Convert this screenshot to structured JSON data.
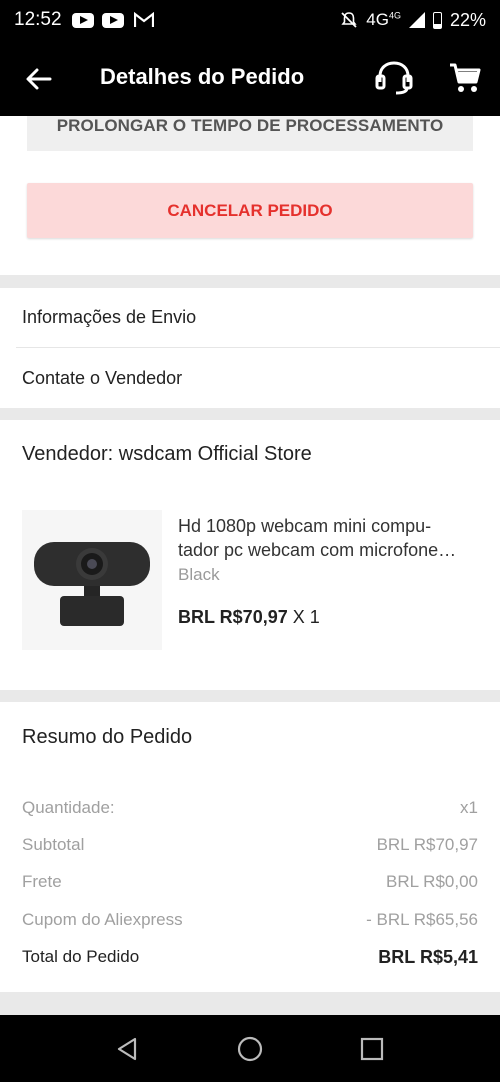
{
  "status_bar": {
    "time": "12:52",
    "network": "4G",
    "battery": "22%"
  },
  "header": {
    "title": "Detalhes do Pedido"
  },
  "actions": {
    "prolong_label": "PROLONGAR O TEMPO DE PROCESSAMENTO",
    "cancel_label": "CANCELAR PEDIDO"
  },
  "links": {
    "shipping_info": "Informações de Envio",
    "contact_seller": "Contate o Vendedor"
  },
  "order": {
    "seller": "Vendedor: wsdcam Official Store",
    "product": {
      "name_line1": "Hd 1080p webcam mini compu-",
      "name_line2": "tador pc webcam com microfone…",
      "variant": "Black",
      "price": "BRL R$70,97",
      "qty": "X 1"
    }
  },
  "summary": {
    "title": "Resumo do Pedido",
    "rows": [
      {
        "label": "Quantidade:",
        "value": "x1"
      },
      {
        "label": "Subtotal",
        "value": "BRL R$70,97"
      },
      {
        "label": "Frete",
        "value": "BRL R$0,00"
      },
      {
        "label": "Cupom do Aliexpress",
        "value": "- BRL R$65,56"
      }
    ],
    "total_label": "Total do Pedido",
    "total_value": "BRL R$5,41"
  },
  "colors": {
    "cancel_text": "#e5312d",
    "cancel_bg": "#fcd9d9",
    "header_bg": "#000000"
  }
}
